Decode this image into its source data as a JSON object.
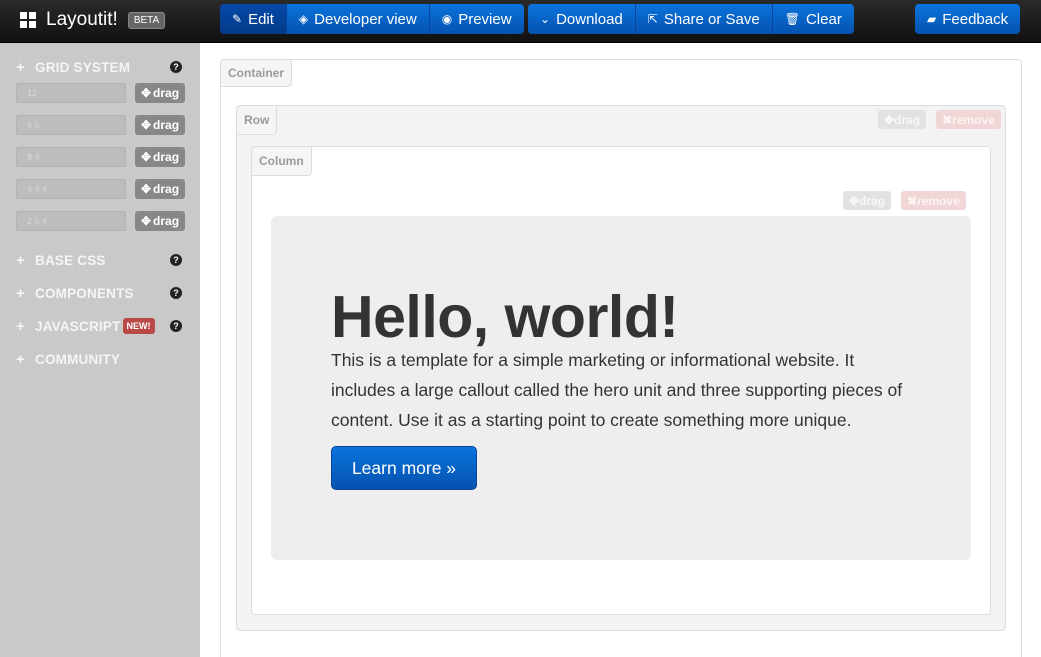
{
  "brand": {
    "name": "Layoutit!",
    "badge": "BETA"
  },
  "toolbar": {
    "edit": "Edit",
    "developer_view": "Developer view",
    "preview": "Preview",
    "download": "Download",
    "share": "Share or Save",
    "clear": "Clear",
    "feedback": "Feedback"
  },
  "sidebar": {
    "sections": {
      "grid": "GRID SYSTEM",
      "base_css": "BASE CSS",
      "components": "COMPONENTS",
      "javascript": "JAVASCRIPT",
      "javascript_badge": "NEW!",
      "community": "COMMUNITY"
    },
    "help_glyph": "?",
    "plus_glyph": "+",
    "drag_label": "drag",
    "grid_rows": [
      {
        "value": "12"
      },
      {
        "value": "6 6"
      },
      {
        "value": "8 4"
      },
      {
        "value": "4 4 4"
      },
      {
        "value": "2 6 4"
      }
    ]
  },
  "canvas": {
    "container_label": "Container",
    "row_label": "Row",
    "column_label": "Column",
    "drag_label": "drag",
    "remove_label": "remove",
    "hero": {
      "heading": "Hello, world!",
      "text": "This is a template for a simple marketing or informational website. It includes a large callout called the hero unit and three supporting pieces of content. Use it as a starting point to create something more unique.",
      "button": "Learn more »"
    }
  },
  "colors": {
    "primary": "#0552b0",
    "navbar": "#1a1a1a",
    "sidebar": "#c9c9c9",
    "danger": "#b94a48"
  }
}
